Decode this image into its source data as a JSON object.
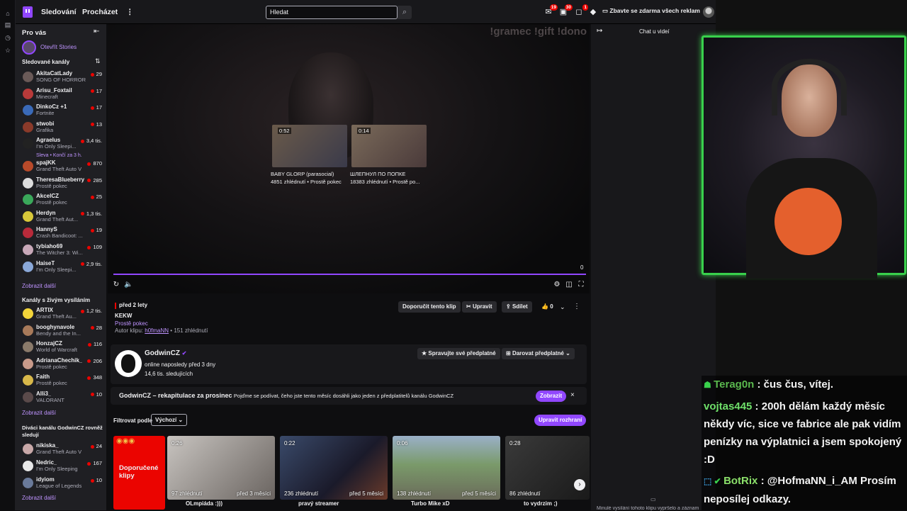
{
  "topbar": {
    "following": "Sledování",
    "browse": "Procházet",
    "more": "⋮",
    "search_placeholder": "Hledat",
    "notif_badges": [
      "19",
      "30",
      "1"
    ],
    "adfree": "Zbavte se zdarma všech reklam"
  },
  "sidebar": {
    "for_you": "Pro vás",
    "stories": "Otevřít Stories",
    "followed_title": "Sledované kanály",
    "followed": [
      {
        "name": "AkitaCatLady",
        "game": "SONG OF HORROR",
        "viewers": "29",
        "color": "#6a5a58"
      },
      {
        "name": "Arisu_Foxtail",
        "game": "Minecraft",
        "viewers": "17",
        "color": "#b83a3a"
      },
      {
        "name": "DinkoCz +1",
        "game": "Fortnite",
        "viewers": "17",
        "color": "#3a6ab8"
      },
      {
        "name": "stwobi",
        "game": "Grafika",
        "viewers": "13",
        "color": "#8a3a2a"
      },
      {
        "name": "Agraelus",
        "game": "I'm Only Sleepi...",
        "viewers": "3,4 tis.",
        "color": "#222"
      },
      {
        "name": "spajKK",
        "game": "Grand Theft Auto V",
        "viewers": "870",
        "color": "#b84a2a"
      },
      {
        "name": "TheresaBlueberry",
        "game": "Prostě pokec",
        "viewers": "285",
        "color": "#ddd"
      },
      {
        "name": "AkcelCZ",
        "game": "Prostě pokec",
        "viewers": "25",
        "color": "#3aa85a"
      },
      {
        "name": "Herdyn",
        "game": "Grand Theft Aut...",
        "viewers": "1,3 tis.",
        "color": "#d8c83a"
      },
      {
        "name": "HannyS",
        "game": "Crash Bandicoot: ...",
        "viewers": "19",
        "color": "#b82a3a"
      },
      {
        "name": "tybiaho69",
        "game": "The Witcher 3: Wi...",
        "viewers": "109",
        "color": "#c8a8b8"
      },
      {
        "name": "HaiseT",
        "game": "I'm Only Sleepi...",
        "viewers": "2,9 tis.",
        "color": "#8aa8d8"
      }
    ],
    "agraelus_promo": "Sleva • Končí za 3 h.",
    "show_more": "Zobrazit další",
    "live_title": "Kanály s živým vysíláním",
    "live": [
      {
        "name": "ARTIX",
        "game": "Grand Theft Au...",
        "viewers": "1,2 tis.",
        "color": "#f2d43a"
      },
      {
        "name": "booghynavole",
        "game": "Bendy and the In...",
        "viewers": "28",
        "color": "#a87a5a"
      },
      {
        "name": "HonzajCZ",
        "game": "World of Warcraft",
        "viewers": "116",
        "color": "#8a7a6a"
      },
      {
        "name": "AdrianaChechik_",
        "game": "Prostě pokec",
        "viewers": "206",
        "color": "#c89a8a"
      },
      {
        "name": "Faith",
        "game": "Prostě pokec",
        "viewers": "348",
        "color": "#d8b84a"
      },
      {
        "name": "Alli3_",
        "game": "VALORANT",
        "viewers": "10",
        "color": "#5a4a4a"
      }
    ],
    "viewers_title": "Diváci kanálu GodwinCZ rovněž sledují",
    "viewers_also": [
      {
        "name": "nikiska_",
        "game": "Grand Theft Auto V",
        "viewers": "24",
        "color": "#c8a8a8"
      },
      {
        "name": "Nedric_",
        "game": "I'm Only Sleeping",
        "viewers": "167",
        "color": "#e8e8e8"
      },
      {
        "name": "idyiom",
        "game": "League of Legends",
        "viewers": "10",
        "color": "#6a7a9a"
      }
    ]
  },
  "player": {
    "overlay_text": "!gramec  !gift  !dono",
    "thumbs": [
      {
        "duration": "0:52",
        "title": "BABY GLORP (parasocial)",
        "meta": "4851 zhlédnutí • Prostě pokec"
      },
      {
        "duration": "0:14",
        "title": "ШЛЕПНУЛ ПО ПОПКЕ",
        "meta": "18383 zhlédnutí • Prostě po..."
      }
    ],
    "count": "0"
  },
  "clip": {
    "ago": "před 2 lety",
    "title": "KEKW",
    "category": "Prostě pokec",
    "author_prefix": "Autor klipu:",
    "author": "h0fmaNN",
    "views": "• 151 zhlédnutí",
    "recommend": "Doporučit tento klip",
    "edit": "Upravit",
    "share": "Sdílet",
    "likes": "0"
  },
  "channel": {
    "name": "GodwinCZ",
    "status": "online naposledy před 3 dny",
    "followers": "14,6 tis. sledujících",
    "manage_subs": "Spravujte své předplatné",
    "gift_sub": "Darovat předplatné"
  },
  "recap": {
    "title": "GodwinCZ – rekapitulace za prosinec",
    "text": "Pojďme se podívat, čeho jste tento měsíc dosáhli jako jeden z předplatitelů kanálu GodwinCZ",
    "button": "Zobrazit"
  },
  "filter": {
    "label": "Filtrovat podle",
    "value": "Výchozí",
    "edit_layout": "Upravit rozhraní"
  },
  "clips": {
    "recommended": "Doporučené klipy",
    "items": [
      {
        "duration": "0:26",
        "views": "97 zhlédnutí",
        "ago": "před 3 měsíci",
        "title": "OLmpiáda :)))"
      },
      {
        "duration": "0:22",
        "views": "236 zhlédnutí",
        "ago": "před 5 měsíci",
        "title": "pravý streamer"
      },
      {
        "duration": "0:06",
        "views": "138 zhlédnutí",
        "ago": "před 5 měsíci",
        "title": "Turbo Mike xD"
      },
      {
        "duration": "0:28",
        "views": "86 zhlédnutí",
        "ago": "",
        "title": "to vydrzim ;)"
      }
    ]
  },
  "chat": {
    "header": "Chat u videí",
    "footer": "Minulé vysílání tohoto klipu vypršelo a záznam"
  },
  "overlay_chat": [
    {
      "user": "Terag0n",
      "text": " : čus čus, vítej."
    },
    {
      "user": "vojtas445",
      "text": " : 200h dělám každý měsíc někdy víc, sice ve fabrice ale pak vidím penízky na výplatnici a jsem spokojený :D"
    },
    {
      "user": "BotRix",
      "text": " : @HofmaNN_i_AM Prosím neposílej odkazy."
    }
  ]
}
